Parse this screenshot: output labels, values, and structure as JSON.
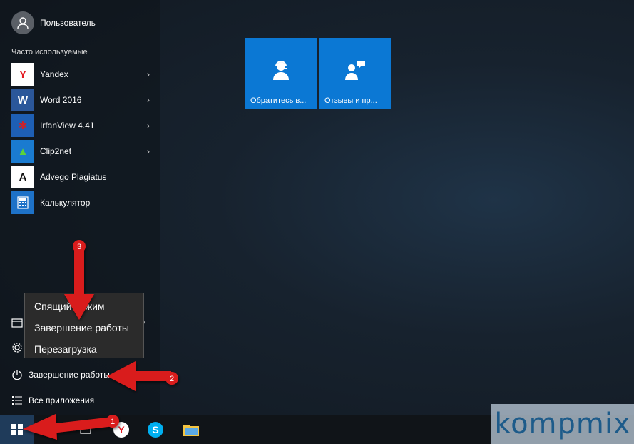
{
  "user": {
    "name": "Пользователь"
  },
  "frequent": {
    "label": "Часто используемые",
    "apps": [
      {
        "label": "Yandex",
        "icon": "yandex-icon",
        "has_submenu": true
      },
      {
        "label": "Word 2016",
        "icon": "word-icon",
        "has_submenu": true
      },
      {
        "label": "IrfanView 4.41",
        "icon": "irfanview-icon",
        "has_submenu": true
      },
      {
        "label": "Clip2net",
        "icon": "clip2net-icon",
        "has_submenu": true
      },
      {
        "label": "Advego Plagiatus",
        "icon": "advego-icon",
        "has_submenu": false
      },
      {
        "label": "Калькулятор",
        "icon": "calculator-icon",
        "has_submenu": false
      }
    ]
  },
  "bottom": {
    "power_label": "Завершение работы",
    "all_apps_label": "Все приложения"
  },
  "power_menu": {
    "items": [
      "Спящий режим",
      "Завершение работы",
      "Перезагрузка"
    ]
  },
  "tiles": [
    {
      "label": "Обратитесь в...",
      "icon": "support-agent-icon"
    },
    {
      "label": "Отзывы и пр...",
      "icon": "feedback-icon"
    }
  ],
  "annotations": {
    "step1": "1",
    "step2": "2",
    "step3": "3"
  },
  "watermark": "kompmix",
  "colors": {
    "tile_blue": "#0b78d4",
    "arrow_red": "#d91c1c"
  }
}
